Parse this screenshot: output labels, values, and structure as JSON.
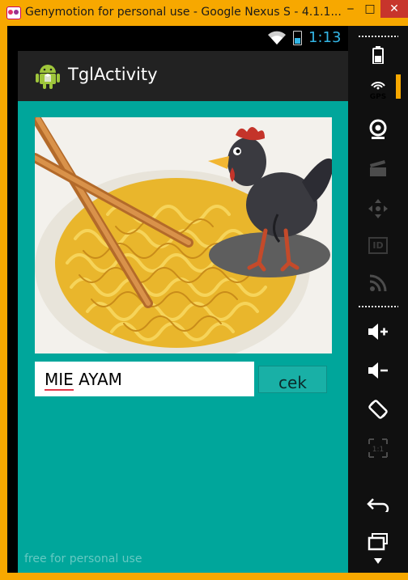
{
  "window": {
    "title": "Genymotion for personal use - Google Nexus S - 4.1.1...",
    "min_glyph": "‒",
    "max_glyph": "□",
    "close_glyph": "✕"
  },
  "status_bar": {
    "time": "1:13",
    "battery_color": "#33b5e5"
  },
  "app": {
    "title": "TglActivity"
  },
  "content": {
    "background": "#00a69b",
    "food_image": {
      "chopsticks": "chopsticks",
      "noodles": "noodles",
      "mascot": "chicken"
    },
    "input_value": "MIE AYAM",
    "input_first_word": "MIE",
    "input_rest": " AYAM",
    "button_label": "cek",
    "watermark": "free for personal use"
  },
  "sidebar": {
    "tools": [
      "battery-icon",
      "gps-icon",
      "webcam-icon",
      "clapper-icon",
      "dpad-icon",
      "id-icon",
      "rss-icon",
      "volume-up-icon",
      "volume-down-icon",
      "rotate-icon",
      "scale-icon",
      "back-icon",
      "recent-apps-icon"
    ],
    "gps_label": "GPS",
    "id_label": "ID",
    "scale_label": "1:1"
  }
}
